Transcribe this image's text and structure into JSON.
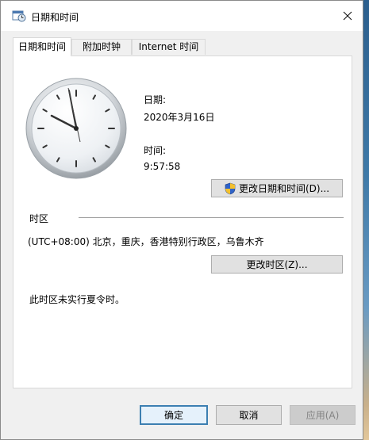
{
  "window": {
    "title": "日期和时间"
  },
  "tabs": [
    {
      "label": "日期和时间"
    },
    {
      "label": "附加时钟"
    },
    {
      "label": "Internet 时间"
    }
  ],
  "datetime": {
    "date_label": "日期:",
    "date_value": "2020年3月16日",
    "time_label": "时间:",
    "time_value": "9:57:58",
    "change_button": "更改日期和时间(D)..."
  },
  "timezone": {
    "section_label": "时区",
    "value": "(UTC+08:00) 北京，重庆，香港特别行政区，乌鲁木齐",
    "change_button": "更改时区(Z)...",
    "dst_note": "此时区未实行夏令时。"
  },
  "footer": {
    "ok": "确定",
    "cancel": "取消",
    "apply": "应用(A)"
  },
  "icons": {
    "title": "calendar-clock-icon",
    "close": "close-icon",
    "uac": "uac-shield-icon"
  }
}
